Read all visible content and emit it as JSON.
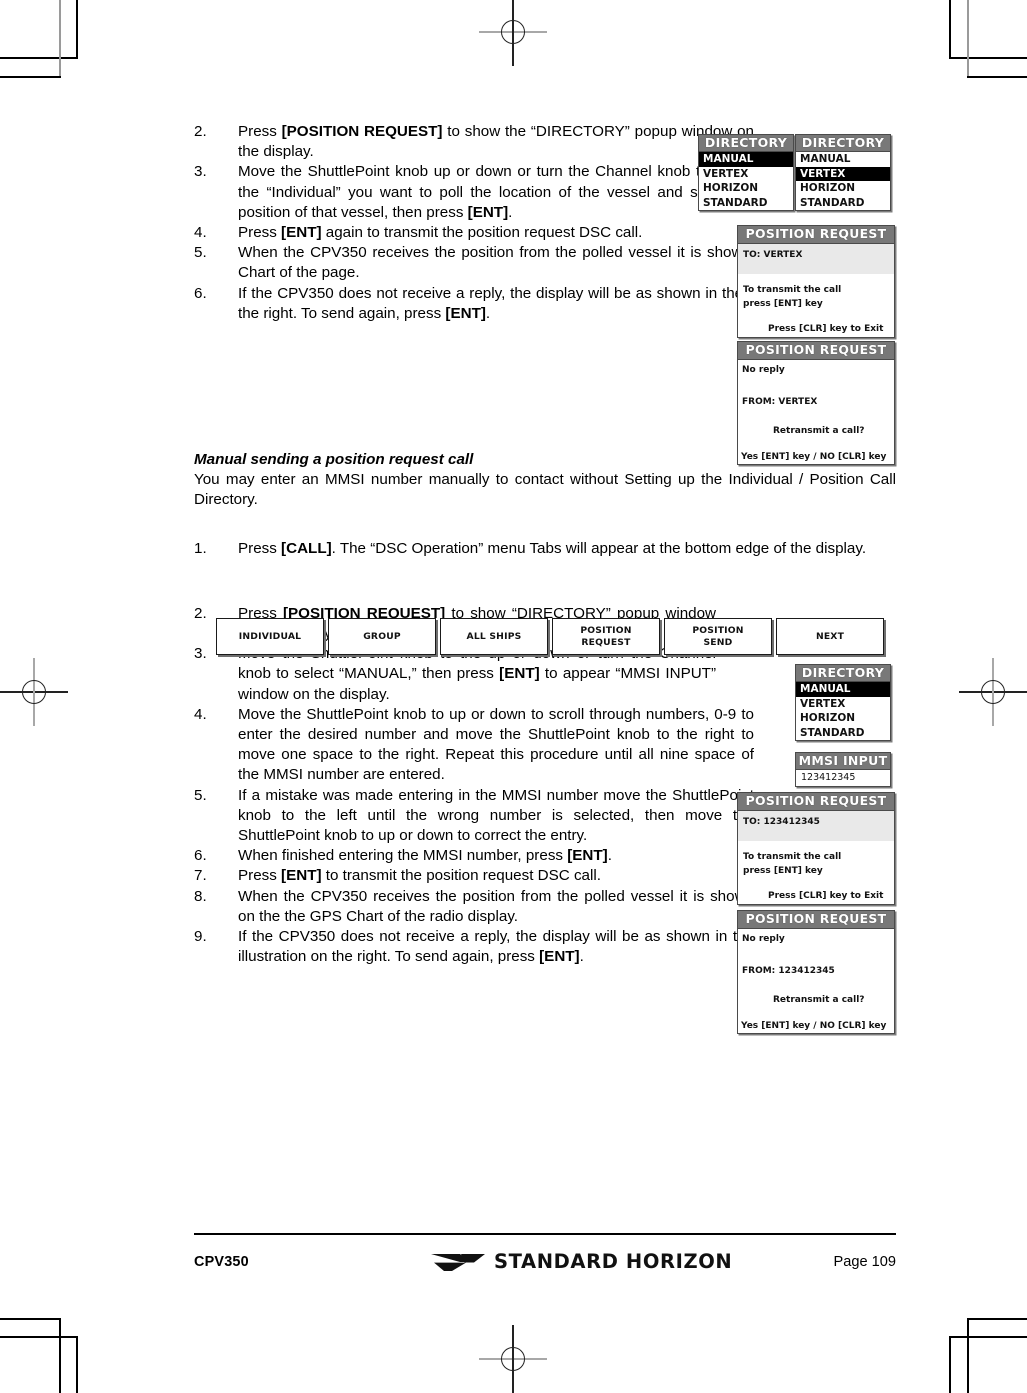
{
  "document": {
    "model": "CPV350",
    "brand": "STANDARD HORIZON",
    "page_label": "Page 109"
  },
  "section_one": {
    "steps": [
      {
        "num": "2.",
        "html": "Press <b>[POSITION REQUEST]</b> to show the “DIRECTORY” popup window on the display."
      },
      {
        "num": "3.",
        "html": "Move the ShuttlePoint knob up or down or turn the Channel knob to select the “Individual” you want to poll the location of the vessel and show the position of that vessel, then press <b>[ENT]</b>."
      },
      {
        "num": "4.",
        "html": "Press <b>[ENT]</b> again to transmit the position request DSC call."
      },
      {
        "num": "5.",
        "html": "When the CPV350 receives the position from the polled vessel it is shown on the GPS Chart of the page."
      },
      {
        "num": "6.",
        "html": "If the CPV350 does not receive a reply, the display will be as shown in the illustration on the right. To send again, press <b>[ENT]</b>."
      }
    ]
  },
  "section_two": {
    "heading": "Manual  sending a position request call",
    "intro": "You may enter an MMSI number manually to contact without Setting up the Individual / Position Call Directory.",
    "steps": [
      {
        "num": "1.",
        "html": "Press <b>[CALL]</b>. The “DSC Operation” menu Tabs will appear at the bottom edge of the display."
      },
      {
        "num": "2.",
        "html": "Press <b>[POSITION REQUEST]</b> to show “DIRECTORY” popup window on the display."
      },
      {
        "num": "3.",
        "html": "Move the ShuttlePoint knob to the up or down or turn the Channel knob to select “MANUAL,” then press <b>[ENT]</b> to appear “MMSI INPUT” window on the display."
      },
      {
        "num": "4.",
        "html": "Move the ShuttlePoint knob to up or down to scroll through numbers, 0-9 to enter the desired number and move the ShuttlePoint knob to the right to move one space to the right. Repeat this procedure until all nine space of the MMSI number are entered."
      },
      {
        "num": "5.",
        "html": "If a mistake was made entering in the MMSI number move the ShuttlePoint knob to the left until the wrong number is selected, then move the ShuttlePoint knob to up or down to correct the entry."
      },
      {
        "num": "6.",
        "html": "When finished entering the MMSI number, press <b>[ENT]</b>."
      },
      {
        "num": "7.",
        "html": "Press <b>[ENT]</b> to transmit the position request DSC call."
      },
      {
        "num": "8.",
        "html": "When the CPV350 receives the position from the polled vessel it is shown on the the GPS Chart of the radio display."
      },
      {
        "num": "9.",
        "html": "If the CPV350 does not receive a reply, the display will be as shown in the illustration on the right. To send again, press <b>[ENT]</b>."
      }
    ]
  },
  "menu_tabs": {
    "tabs": [
      {
        "line1": "INDIVIDUAL",
        "line2": ""
      },
      {
        "line1": "GROUP",
        "line2": ""
      },
      {
        "line1": "ALL SHIPS",
        "line2": ""
      },
      {
        "line1": "POSITION",
        "line2": "REQUEST"
      },
      {
        "line1": "POSITION",
        "line2": "SEND"
      },
      {
        "line1": "NEXT",
        "line2": ""
      }
    ]
  },
  "lcd": {
    "directory_manual": {
      "title": "DIRECTORY",
      "rows": [
        {
          "label": "MANUAL",
          "selected": true
        },
        {
          "label": "VERTEX",
          "selected": false
        },
        {
          "label": "HORIZON",
          "selected": false
        },
        {
          "label": "STANDARD",
          "selected": false
        }
      ]
    },
    "directory_vertex": {
      "title": "DIRECTORY",
      "rows": [
        {
          "label": "MANUAL",
          "selected": false
        },
        {
          "label": "VERTEX",
          "selected": true
        },
        {
          "label": "HORIZON",
          "selected": false
        },
        {
          "label": "STANDARD",
          "selected": false
        }
      ]
    },
    "directory_manual_2": {
      "title": "DIRECTORY",
      "rows": [
        {
          "label": "MANUAL",
          "selected": true
        },
        {
          "label": "VERTEX",
          "selected": false
        },
        {
          "label": "HORIZON",
          "selected": false
        },
        {
          "label": "STANDARD",
          "selected": false
        }
      ]
    },
    "mmsi_input": {
      "title": "MMSI INPUT",
      "value": "123412345"
    },
    "posreq_to_vertex": {
      "title": "POSITION REQUEST",
      "to": "TO: VERTEX",
      "line1": "To transmit the call",
      "line2": "press [ENT] key",
      "exit": "Press [CLR] key to Exit"
    },
    "posreq_noreply_vertex": {
      "title": "POSITION REQUEST",
      "noreply": "No reply",
      "from": "FROM: VERTEX",
      "retransmit": "Retransmit a call?",
      "yesno": "Yes [ENT] key / NO [CLR] key"
    },
    "posreq_to_mmsi": {
      "title": "POSITION REQUEST",
      "to": "TO: 123412345",
      "line1": "To transmit the call",
      "line2": "press [ENT] key",
      "exit": "Press [CLR] key to Exit"
    },
    "posreq_noreply_mmsi": {
      "title": "POSITION REQUEST",
      "noreply": "No reply",
      "from": "FROM: 123412345",
      "retransmit": "Retransmit a call?",
      "yesno": "Yes [ENT] key / NO [CLR] key"
    }
  },
  "colors": {
    "lcd_title_bg": "#787878",
    "lcd_selected_bg": "#000000",
    "page_bg": "#ffffff",
    "ink": "#000000"
  }
}
